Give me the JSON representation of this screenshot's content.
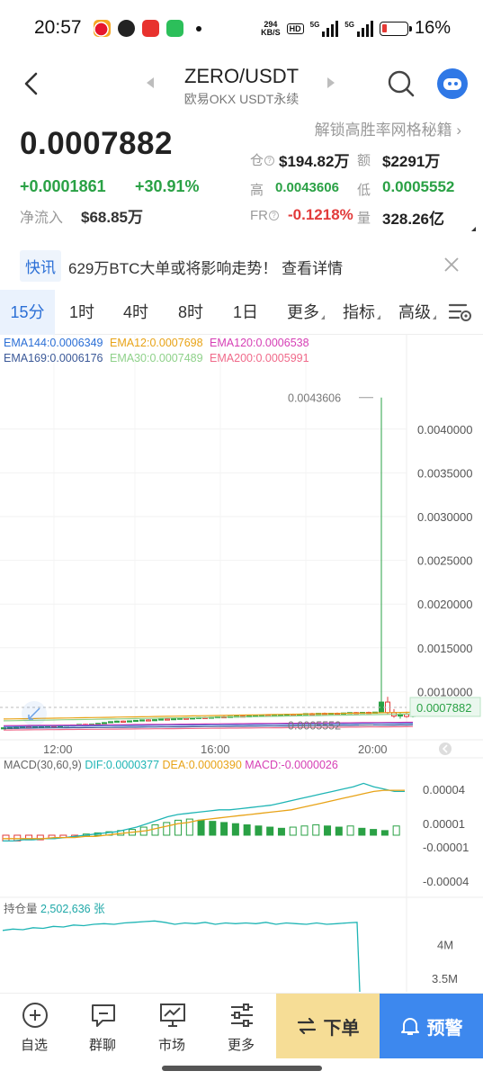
{
  "status_bar": {
    "time": "20:57",
    "net_speed_top": "294",
    "net_speed_unit": "KB/S",
    "hd": "HD",
    "sig1": "5G",
    "sig2": "5G",
    "battery": "16%"
  },
  "header": {
    "title": "ZERO/USDT",
    "subtitle": "欧易OKX USDT永续"
  },
  "price": {
    "unlock_link": "解锁高胜率网格秘籍",
    "last": "0.0007882",
    "change_abs": "+0.0001861",
    "change_pct": "+30.91%",
    "inflow_label": "净流入",
    "inflow_value": "$68.85万"
  },
  "stats": {
    "oi_label": "仓",
    "oi_value": "$194.82万",
    "amount_label": "额",
    "amount_value": "$2291万",
    "high_label": "高",
    "high_value": "0.0043606",
    "low_label": "低",
    "low_value": "0.0005552",
    "fr_label": "FR",
    "fr_value": "-0.1218%",
    "vol_label": "量",
    "vol_value": "328.26亿"
  },
  "news": {
    "tag": "快讯",
    "text": "629万BTC大单或将影响走势！ 查看详情"
  },
  "tabs": [
    {
      "label": "15分",
      "active": true
    },
    {
      "label": "1时"
    },
    {
      "label": "4时"
    },
    {
      "label": "8时"
    },
    {
      "label": "1日"
    },
    {
      "label": "更多"
    },
    {
      "label": "指标"
    },
    {
      "label": "高级"
    }
  ],
  "colors": {
    "up": "#2aa145",
    "down": "#e23b3b",
    "accent": "#2b6fd6",
    "ema144": "#2b6fd6",
    "ema12": "#e8a317",
    "ema120": "#d63fb5",
    "ema169": "#3b5998",
    "ema30": "#8fd18a",
    "ema200": "#f06a8a",
    "dif": "#1fb5b5",
    "dea": "#e8a317",
    "macd": "#d63fb5"
  },
  "ema": {
    "ema144": "EMA144:0.0006349",
    "ema12": "EMA12:0.0007698",
    "ema120": "EMA120:0.0006538",
    "ema169": "EMA169:0.0006176",
    "ema30": "EMA30:0.0007489",
    "ema200": "EMA200:0.0005991"
  },
  "chart_data": [
    {
      "type": "candlestick",
      "title": "",
      "x": [
        "12:00",
        "16:00",
        "20:00"
      ],
      "y_ticks": [
        "0.0040000",
        "0.0035000",
        "0.0030000",
        "0.0025000",
        "0.0020000",
        "0.0015000",
        "0.0010000"
      ],
      "ylim": [
        0.0005,
        0.0045
      ],
      "high_marker": 0.0043606,
      "high_marker_label": "0.0043606",
      "low_marker": 0.0005552,
      "low_marker_label": "0.0005552",
      "last_price": 0.0007882,
      "last_price_label": "0.0007882",
      "candles": [
        [
          0.000585,
          0.00059,
          0.00058,
          0.000586
        ],
        [
          0.000586,
          0.000592,
          0.000583,
          0.000589
        ],
        [
          0.000589,
          0.000595,
          0.000585,
          0.000591
        ],
        [
          0.000591,
          0.000598,
          0.000588,
          0.000595
        ],
        [
          0.000595,
          0.0006,
          0.00059,
          0.000594
        ],
        [
          0.000594,
          0.000602,
          0.000591,
          0.000599
        ],
        [
          0.000599,
          0.000606,
          0.000595,
          0.000603
        ],
        [
          0.000603,
          0.00061,
          0.0006,
          0.000608
        ],
        [
          0.000608,
          0.000612,
          0.000602,
          0.000605
        ],
        [
          0.000605,
          0.000612,
          0.000601,
          0.00061
        ],
        [
          0.00061,
          0.000618,
          0.000606,
          0.000615
        ],
        [
          0.000615,
          0.000622,
          0.000611,
          0.000619
        ],
        [
          0.000619,
          0.000628,
          0.000615,
          0.000625
        ],
        [
          0.000625,
          0.000632,
          0.00062,
          0.000622
        ],
        [
          0.000622,
          0.00063,
          0.000618,
          0.000628
        ],
        [
          0.000628,
          0.00064,
          0.000624,
          0.000636
        ],
        [
          0.000636,
          0.00065,
          0.000632,
          0.000645
        ],
        [
          0.000645,
          0.00066,
          0.00064,
          0.000656
        ],
        [
          0.000656,
          0.000668,
          0.00065,
          0.000662
        ],
        [
          0.000662,
          0.00067,
          0.000655,
          0.000658
        ],
        [
          0.000658,
          0.000668,
          0.000652,
          0.000665
        ],
        [
          0.000665,
          0.000675,
          0.00066,
          0.000671
        ],
        [
          0.000671,
          0.00068,
          0.000665,
          0.000676
        ],
        [
          0.000676,
          0.000684,
          0.00067,
          0.000672
        ],
        [
          0.000672,
          0.000682,
          0.000668,
          0.000679
        ],
        [
          0.000679,
          0.00069,
          0.000674,
          0.000686
        ],
        [
          0.000686,
          0.000694,
          0.00068,
          0.000683
        ],
        [
          0.000683,
          0.000692,
          0.000678,
          0.00069
        ],
        [
          0.00069,
          0.000698,
          0.000684,
          0.000695
        ],
        [
          0.000695,
          0.000702,
          0.000688,
          0.000692
        ],
        [
          0.000692,
          0.000702,
          0.000686,
          0.000699
        ],
        [
          0.000699,
          0.000708,
          0.000693,
          0.000704
        ],
        [
          0.000704,
          0.000712,
          0.000698,
          0.000701
        ],
        [
          0.000701,
          0.00071,
          0.000695,
          0.000707
        ],
        [
          0.000707,
          0.000716,
          0.000702,
          0.000712
        ],
        [
          0.000712,
          0.00072,
          0.000706,
          0.000709
        ],
        [
          0.000709,
          0.000718,
          0.000703,
          0.000715
        ],
        [
          0.000715,
          0.000724,
          0.000709,
          0.00072
        ],
        [
          0.00072,
          0.000728,
          0.000714,
          0.000716
        ],
        [
          0.000716,
          0.000726,
          0.000711,
          0.000722
        ],
        [
          0.000722,
          0.00073,
          0.000716,
          0.000726
        ],
        [
          0.000726,
          0.000734,
          0.00072,
          0.000729
        ],
        [
          0.000729,
          0.000736,
          0.000722,
          0.000725
        ],
        [
          0.000725,
          0.000735,
          0.00072,
          0.000731
        ],
        [
          0.000731,
          0.00074,
          0.000726,
          0.000736
        ],
        [
          0.000736,
          0.000745,
          0.00073,
          0.00074
        ],
        [
          0.00074,
          0.000748,
          0.000733,
          0.000737
        ],
        [
          0.000737,
          0.000746,
          0.000731,
          0.000742
        ],
        [
          0.000742,
          0.000752,
          0.000736,
          0.000748
        ],
        [
          0.000748,
          0.000756,
          0.000741,
          0.000744
        ],
        [
          0.000744,
          0.000754,
          0.000739,
          0.000751
        ],
        [
          0.000751,
          0.00076,
          0.000744,
          0.000746
        ],
        [
          0.000746,
          0.000756,
          0.00074,
          0.000752
        ],
        [
          0.000752,
          0.00076,
          0.000746,
          0.000749
        ],
        [
          0.000749,
          0.000758,
          0.000743,
          0.000755
        ],
        [
          0.000755,
          0.000764,
          0.000749,
          0.00076
        ],
        [
          0.00076,
          0.000768,
          0.000752,
          0.000756
        ],
        [
          0.000756,
          0.000766,
          0.00075,
          0.000762
        ],
        [
          0.000762,
          0.00077,
          0.000755,
          0.000758
        ],
        [
          0.000758,
          0.000768,
          0.000752,
          0.000765
        ],
        [
          0.000765,
          0.004361,
          0.00076,
          0.00088
        ],
        [
          0.00088,
          0.00094,
          0.00074,
          0.00076
        ],
        [
          0.00076,
          0.0008,
          0.0007,
          0.00072
        ],
        [
          0.00072,
          0.00076,
          0.00069,
          0.00074
        ],
        [
          0.00074,
          0.00077,
          0.0007,
          0.000715
        ],
        [
          0.000715,
          0.0008,
          0.000705,
          0.000788
        ]
      ]
    },
    {
      "type": "bar",
      "title": "MACD(30,60,9)",
      "dif_label": "DIF:0.0000377",
      "dea_label": "DEA:0.0000390",
      "macd_label": "MACD:-0.0000026",
      "y_ticks": [
        "0.00004",
        "0.00001",
        "-0.00001",
        "-0.00004"
      ],
      "ylim": [
        -5e-05,
        5e-05
      ],
      "dif": [
        -5e-06,
        -5e-06,
        -4e-06,
        -4e-06,
        -3e-06,
        -3e-06,
        -2e-06,
        -1e-06,
        0,
        1e-06,
        2e-06,
        3e-06,
        5e-06,
        7e-06,
        1e-05,
        1.3e-05,
        1.6e-05,
        1.8e-05,
        1.9e-05,
        2e-05,
        2.1e-05,
        2.2e-05,
        2.2e-05,
        2.3e-05,
        2.4e-05,
        2.5e-05,
        2.6e-05,
        2.8e-05,
        3e-05,
        3.2e-05,
        3.4e-05,
        3.6e-05,
        3.8e-05,
        4e-05,
        4.2e-05,
        4.5e-05,
        4.2e-05,
        4e-05,
        3.8e-05,
        3.8e-05
      ],
      "dea": [
        -3e-06,
        -3e-06,
        -3e-06,
        -3e-06,
        -3e-06,
        -2e-06,
        -2e-06,
        -2e-06,
        -1e-06,
        -1e-06,
        0,
        1e-06,
        2e-06,
        3e-06,
        4e-06,
        6e-06,
        8e-06,
        1e-05,
        1.1e-05,
        1.3e-05,
        1.4e-05,
        1.5e-05,
        1.6e-05,
        1.7e-05,
        1.8e-05,
        1.9e-05,
        2e-05,
        2.1e-05,
        2.2e-05,
        2.4e-05,
        2.6e-05,
        2.8e-05,
        3e-05,
        3.2e-05,
        3.4e-05,
        3.6e-05,
        3.8e-05,
        3.9e-05,
        3.9e-05,
        3.9e-05
      ],
      "macd": [
        -5e-06,
        -5e-06,
        -4e-06,
        -4e-06,
        -3e-06,
        -2e-06,
        -1e-06,
        1e-06,
        2e-06,
        3e-06,
        4e-06,
        5e-06,
        7e-06,
        9e-06,
        1.1e-05,
        1.3e-05,
        1.4e-05,
        1.3e-05,
        1.2e-05,
        1.1e-05,
        1e-05,
        9e-06,
        8e-06,
        7e-06,
        6e-06,
        7e-06,
        8e-06,
        9e-06,
        8e-06,
        7e-06,
        8e-06,
        6e-06,
        5e-06,
        4e-06,
        8e-06,
        1e-05,
        4e-06,
        -1e-06,
        -3e-06,
        -3e-06
      ]
    },
    {
      "type": "line",
      "title": "持仓量",
      "value_label": "2,502,636 张",
      "y_ticks": [
        "4M",
        "3.5M"
      ],
      "ylim": [
        3300000,
        4500000
      ],
      "values": [
        4210000,
        4230000,
        4220000,
        4250000,
        4240000,
        4270000,
        4260000,
        4290000,
        4280000,
        4300000,
        4310000,
        4300000,
        4320000,
        4330000,
        4340000,
        4350000,
        4330000,
        4300000,
        4320000,
        4310000,
        4330000,
        4300000,
        4320000,
        4310000,
        4320000,
        4310000,
        4330000,
        4300000,
        4320000,
        4310000,
        4300000,
        4320000,
        4300000,
        4310000,
        4320000,
        4330000,
        3300000
      ]
    }
  ],
  "bottom_nav": {
    "items": [
      {
        "label": "自选"
      },
      {
        "label": "群聊"
      },
      {
        "label": "市场"
      },
      {
        "label": "更多"
      }
    ],
    "order": "下单",
    "alert": "预警"
  }
}
